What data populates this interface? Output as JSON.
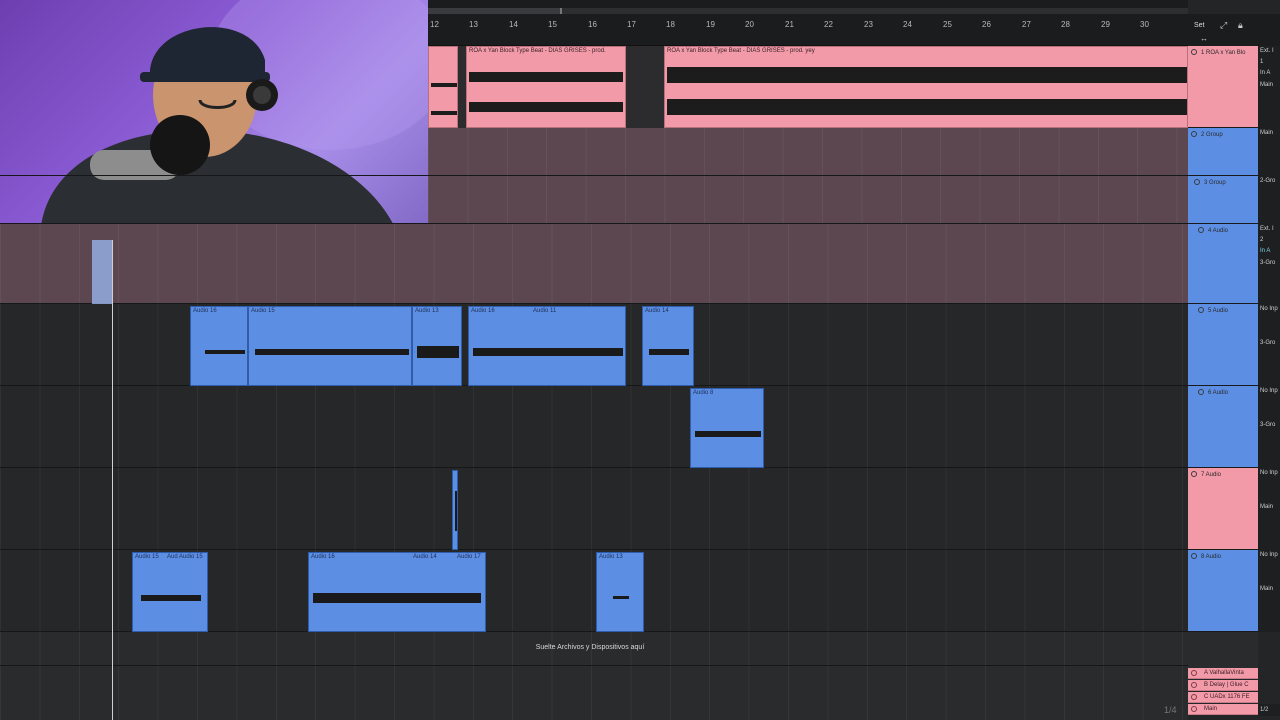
{
  "ruler": {
    "bars": [
      "12",
      "13",
      "14",
      "15",
      "16",
      "17",
      "18",
      "19",
      "20",
      "21",
      "22",
      "23",
      "24",
      "25",
      "26",
      "27",
      "28",
      "29",
      "30"
    ],
    "set_label": "Set"
  },
  "clips": {
    "track1": [
      {
        "name": ""
      },
      {
        "name": "ROA x Yan Block Type Beat - DIAS GRISES - prod."
      },
      {
        "name": "ROA x Yan Block Type Beat - DIAS GRISES - prod. yey"
      }
    ],
    "track5": [
      {
        "name": "Audio 16"
      },
      {
        "name": "Audio 15"
      },
      {
        "name": "Audio 13"
      },
      {
        "name": "Audio 16"
      },
      {
        "name": "Audio 11"
      },
      {
        "name": "Audio 14"
      }
    ],
    "track6": [
      {
        "name": "Audio 8"
      }
    ],
    "track8": [
      {
        "name": "Audio 15"
      },
      {
        "name": "Aud Audio 15"
      },
      {
        "name": "Audio 16"
      },
      {
        "name": "Audio 14"
      },
      {
        "name": "Audio 17"
      },
      {
        "name": "Audio 13"
      }
    ]
  },
  "tracks": [
    {
      "label": "1 ROA x Yan Blo",
      "io": [
        "Ext. I",
        "1",
        "In  A",
        "Main"
      ]
    },
    {
      "label": "2 Group",
      "io": [
        "Main"
      ]
    },
    {
      "label": "3 Group",
      "io": [
        "2-Gro"
      ]
    },
    {
      "label": "4 Audio",
      "io": [
        "Ext. I",
        "2",
        "In  A",
        "3-Gro"
      ]
    },
    {
      "label": "5 Audio",
      "io": [
        "No Inp",
        "3-Gro"
      ]
    },
    {
      "label": "6 Audio",
      "io": [
        "No Inp",
        "3-Gro"
      ]
    },
    {
      "label": "7 Audio",
      "io": [
        "No Inp",
        "Main"
      ]
    },
    {
      "label": "8 Audio",
      "io": [
        "No Inp",
        "Main"
      ]
    }
  ],
  "returns": [
    {
      "label": "A ValhallaVinta"
    },
    {
      "label": "B Delay | Glue C"
    },
    {
      "label": "C UADx 1176 FE"
    },
    {
      "label": "Main"
    }
  ],
  "drop_hint": "Suelte Archivos y Dispositivos aquí",
  "page_indicator": "1/4",
  "main_indicator": "1/2",
  "colors": {
    "pink_clip": "#f39aa8",
    "blue_clip": "#5c8fe4",
    "group_lane": "#5c4750",
    "background": "#242527"
  }
}
